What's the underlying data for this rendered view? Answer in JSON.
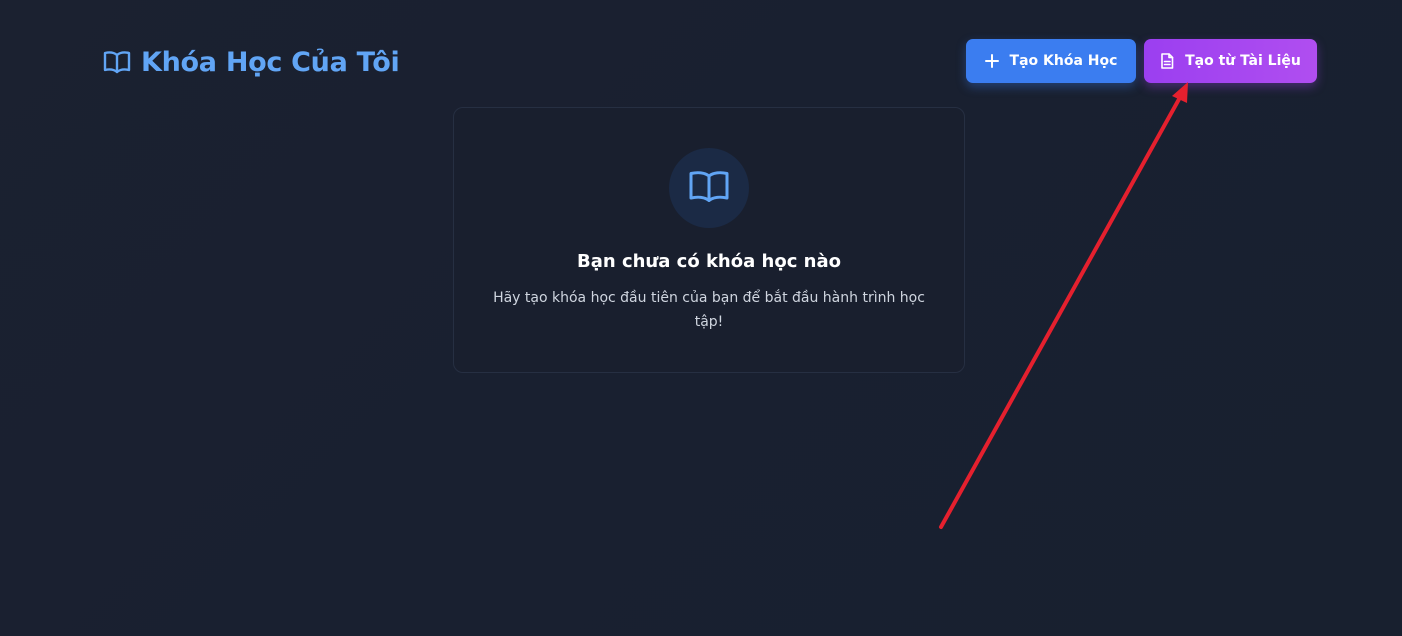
{
  "header": {
    "title": "Khóa Học Của Tôi",
    "title_icon": "book-open-icon"
  },
  "actions": {
    "create_course_label": "Tạo Khóa Học",
    "create_course_icon": "plus-icon",
    "create_from_doc_label": "Tạo từ Tài Liệu",
    "create_from_doc_icon": "document-icon"
  },
  "empty_state": {
    "icon": "book-open-icon",
    "title": "Bạn chưa có khóa học nào",
    "description": "Hãy tạo khóa học đầu tiên của bạn để bắt đầu hành trình học tập!"
  },
  "annotation": {
    "arrow_color": "#e5202e"
  },
  "colors": {
    "background": "#1a2030",
    "accent_blue": "#3b7df0",
    "accent_purple": "#a347f0",
    "title_blue": "#61a5f5"
  }
}
